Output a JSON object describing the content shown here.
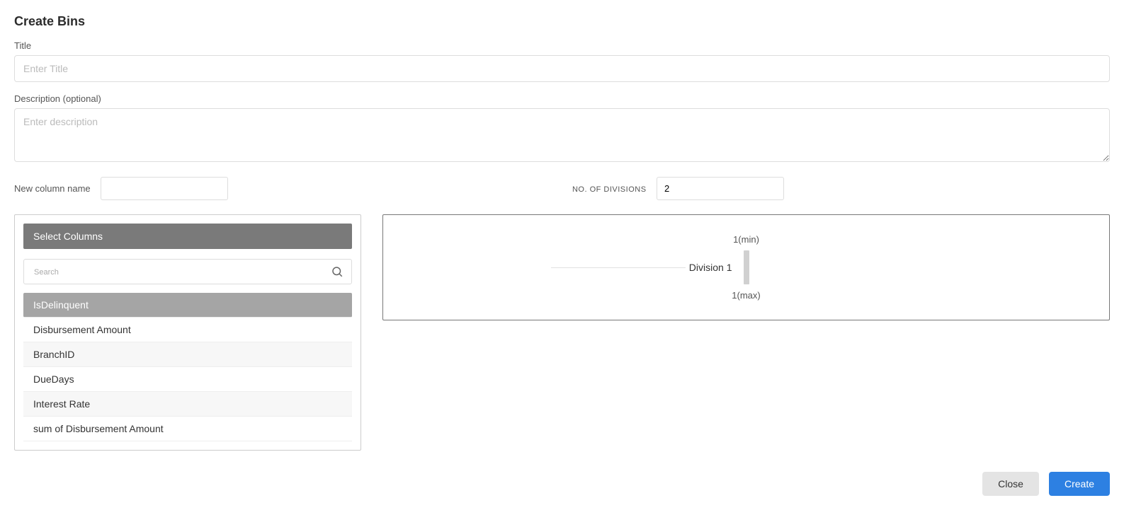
{
  "heading": "Create Bins",
  "title_field": {
    "label": "Title",
    "placeholder": "Enter Title",
    "value": ""
  },
  "description_field": {
    "label": "Description (optional)",
    "placeholder": "Enter description",
    "value": ""
  },
  "new_column": {
    "label": "New column name",
    "value": ""
  },
  "divisions": {
    "label": "NO. OF DIVISIONS",
    "value": "2"
  },
  "select_columns": {
    "header": "Select Columns",
    "search_placeholder": "Search",
    "items": [
      "IsDelinquent",
      "Disbursement Amount",
      "BranchID",
      "DueDays",
      "Interest Rate",
      "sum of Disbursement Amount"
    ],
    "selected_index": 0
  },
  "division_preview": {
    "min_label": "1(min)",
    "division_label": "Division 1",
    "max_label": "1(max)"
  },
  "buttons": {
    "close": "Close",
    "create": "Create"
  }
}
